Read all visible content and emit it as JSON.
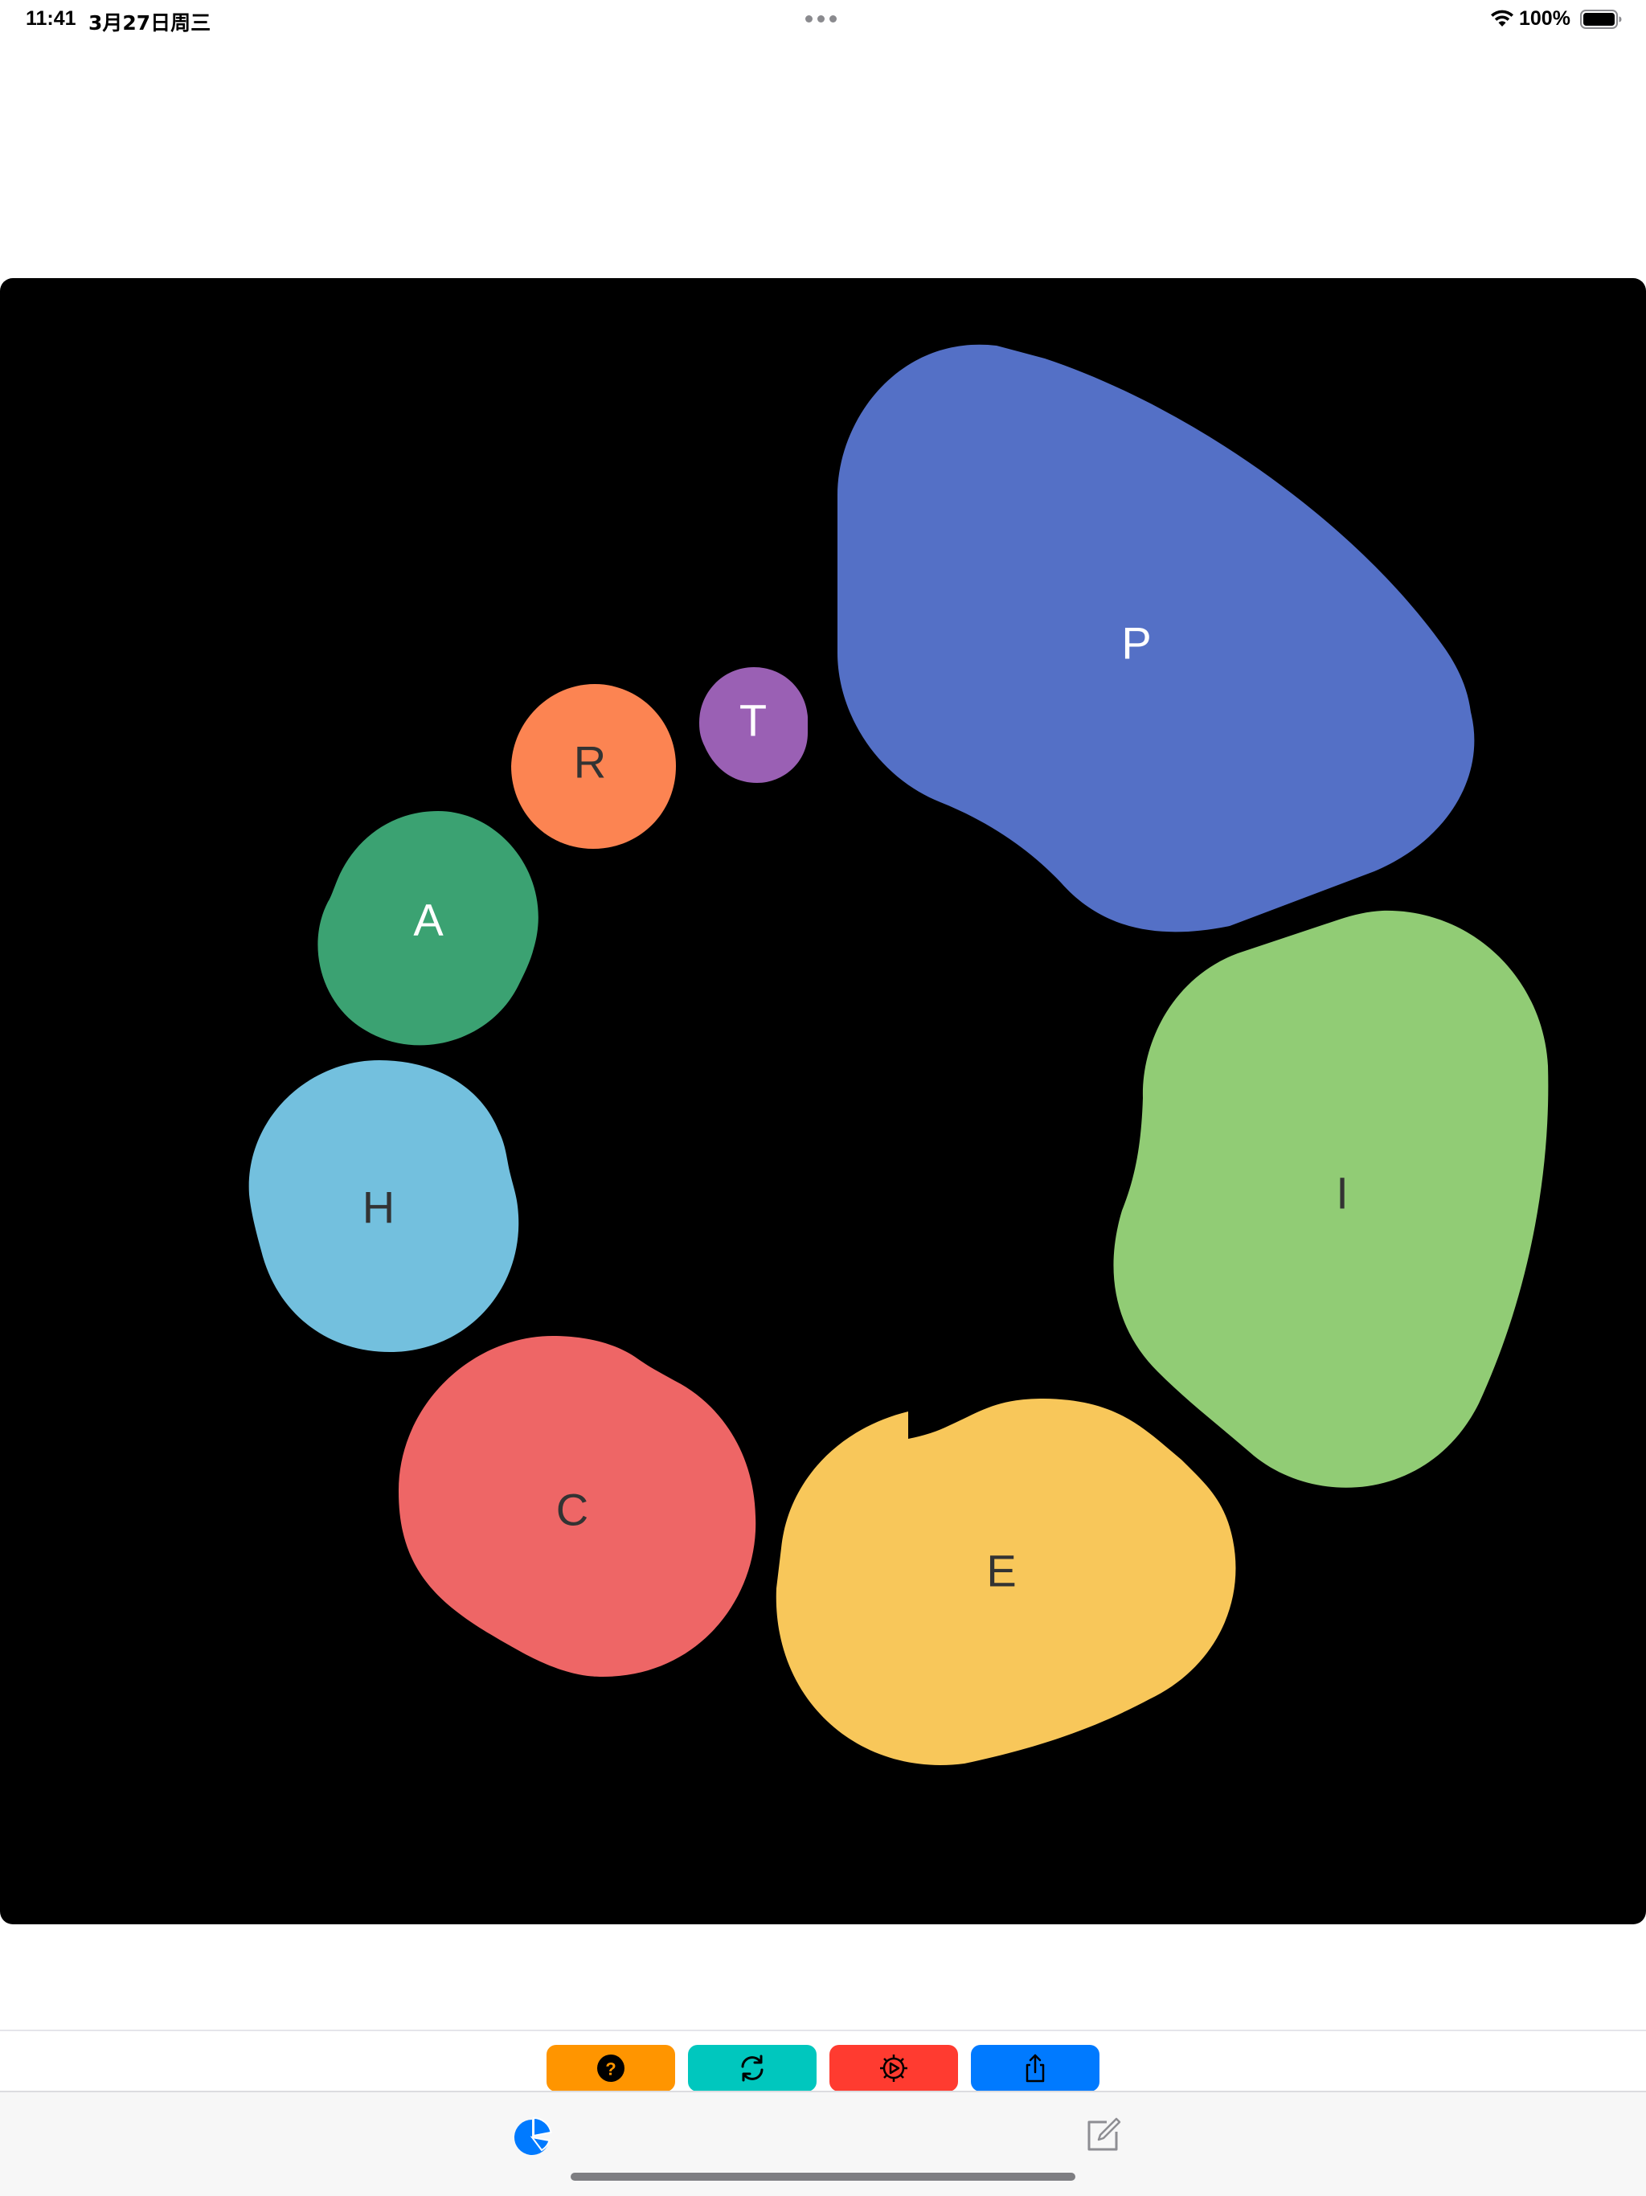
{
  "status_bar": {
    "time": "11:41",
    "date": "3月27日周三",
    "battery_percent": "100%",
    "battery_level": 1.0
  },
  "canvas": {
    "background_color": "#000000",
    "blobs": [
      {
        "id": "P",
        "label": "P",
        "color": "#5470c6",
        "text_color": "#ffffff"
      },
      {
        "id": "I",
        "label": "I",
        "color": "#91cc75",
        "text_color": "#333333"
      },
      {
        "id": "E",
        "label": "E",
        "color": "#f8c75a",
        "text_color": "#333333"
      },
      {
        "id": "C",
        "label": "C",
        "color": "#ee6666",
        "text_color": "#333333"
      },
      {
        "id": "H",
        "label": "H",
        "color": "#73c0de",
        "text_color": "#333333"
      },
      {
        "id": "A",
        "label": "A",
        "color": "#3ba272",
        "text_color": "#ffffff"
      },
      {
        "id": "R",
        "label": "R",
        "color": "#fc8452",
        "text_color": "#333333"
      },
      {
        "id": "T",
        "label": "T",
        "color": "#9a60b4",
        "text_color": "#ffffff"
      }
    ]
  },
  "toolbar": {
    "buttons": [
      {
        "id": "help",
        "icon": "question-circle-icon",
        "color": "#ff9500"
      },
      {
        "id": "refresh",
        "icon": "refresh-icon",
        "color": "#00c7be"
      },
      {
        "id": "settings",
        "icon": "gear-play-icon",
        "color": "#ff3b30"
      },
      {
        "id": "share",
        "icon": "share-icon",
        "color": "#007aff"
      }
    ]
  },
  "tabbar": {
    "tabs": [
      {
        "id": "chart",
        "icon": "pie-chart-icon",
        "selected": true,
        "color": "#007aff"
      },
      {
        "id": "edit",
        "icon": "edit-square-icon",
        "selected": false,
        "color": "#8e8e93"
      }
    ]
  }
}
